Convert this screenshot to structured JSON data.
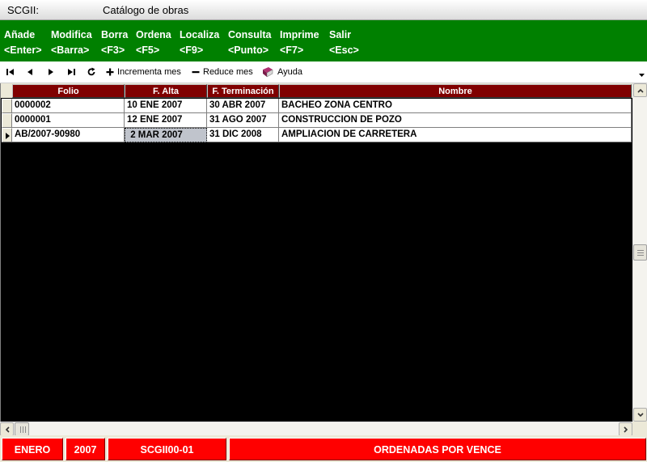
{
  "window": {
    "app_name": "SCGII:",
    "title": "Catálogo de obras"
  },
  "menu": [
    {
      "label": "Añade",
      "key": "<Enter>"
    },
    {
      "label": "Modifica",
      "key": "<Barra>"
    },
    {
      "label": "Borra",
      "key": "<F3>"
    },
    {
      "label": "Ordena",
      "key": "<F5>"
    },
    {
      "label": "Localiza",
      "key": "<F9>"
    },
    {
      "label": "Consulta",
      "key": "<Punto>"
    },
    {
      "label": "Imprime",
      "key": "<F7>"
    },
    {
      "label": "Salir",
      "key": "<Esc>"
    }
  ],
  "toolbar": {
    "increment_label": "Incrementa mes",
    "reduce_label": "Reduce mes",
    "help_label": "Ayuda"
  },
  "grid": {
    "columns": [
      "Folio",
      "F. Alta",
      "F. Terminación",
      "Nombre"
    ],
    "rows": [
      {
        "folio": "0000002",
        "alta": "10 ENE 2007",
        "terminacion": "30 ABR 2007",
        "nombre": "BACHEO ZONA CENTRO"
      },
      {
        "folio": "0000001",
        "alta": "12 ENE 2007",
        "terminacion": "31 AGO 2007",
        "nombre": "CONSTRUCCION DE POZO"
      },
      {
        "folio": "AB/2007-90980",
        "alta": " 2 MAR 2007",
        "terminacion": "31 DIC 2008",
        "nombre": "AMPLIACION DE CARRETERA"
      }
    ]
  },
  "status": {
    "month": "ENERO",
    "year": "2007",
    "code": "SCGII00-01",
    "message": "ORDENADAS POR VENCE"
  },
  "colors": {
    "menu_bg": "#008000",
    "header_bg": "#800000",
    "status_bg": "#ff0000",
    "grid_bg": "#000000"
  }
}
